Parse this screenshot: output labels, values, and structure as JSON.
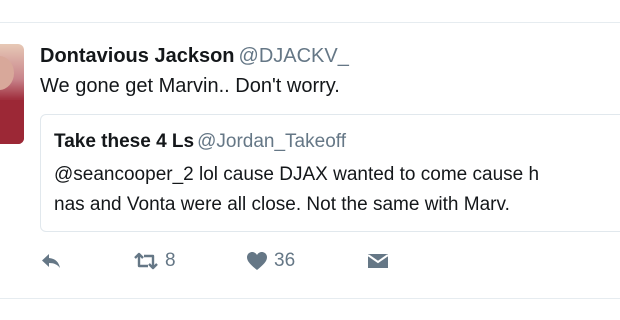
{
  "tweet": {
    "display_name": "Dontavious Jackson",
    "handle": "@DJACKV_",
    "text": "We gone get Marvin.. Don't worry.",
    "avatar_icon": "user-avatar"
  },
  "quoted_tweet": {
    "display_name": "Take these 4 Ls",
    "handle": "@Jordan_Takeoff",
    "text_line_1": "@seancooper_2 lol cause DJAX wanted to come cause h",
    "text_line_2": "nas and Vonta were all close. Not the same with Marv."
  },
  "actions": {
    "reply_icon": "reply-icon",
    "retweet_icon": "retweet-icon",
    "retweet_count": "8",
    "like_icon": "heart-icon",
    "like_count": "36",
    "message_icon": "envelope-icon"
  },
  "colors": {
    "text_primary": "#14171a",
    "text_secondary": "#657786",
    "border": "#e1e8ed"
  }
}
